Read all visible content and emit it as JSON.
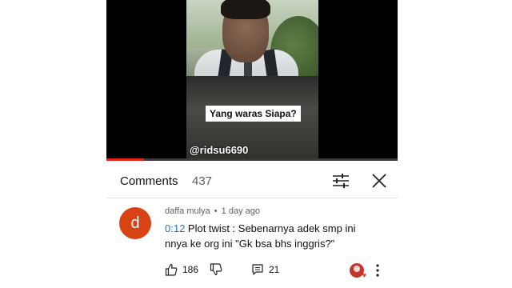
{
  "video": {
    "caption": "Yang waras Siapa?",
    "handle": "@ridsu6690",
    "progress": 0.13
  },
  "comments_header": {
    "title": "Comments",
    "count": "437",
    "sort_icon": "tune-icon",
    "close_icon": "close-icon"
  },
  "comment": {
    "avatar_letter": "d",
    "avatar_color": "#d84315",
    "author": "daffa mulya",
    "separator": "•",
    "time": "1 day ago",
    "timestamp_link": "0:12",
    "text_line1": " Plot twist : Sebenarnya adek smp ini",
    "text_line2": "nnya ke org ini \"Gk bsa bhs inggris?\"",
    "likes": "186",
    "replies": "21",
    "icons": {
      "like": "thumbs-up-icon",
      "dislike": "thumbs-down-icon",
      "reply": "reply-icon",
      "creator_heart": "creator-heart-icon",
      "more": "more-vertical-icon"
    }
  },
  "colors": {
    "progress": "#e62117",
    "link": "#1a73e8"
  }
}
